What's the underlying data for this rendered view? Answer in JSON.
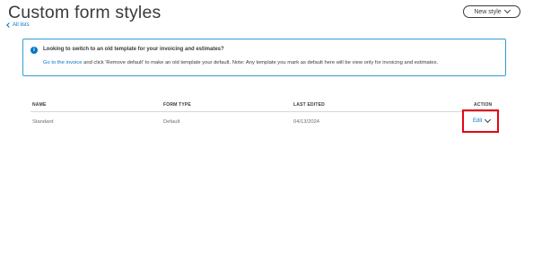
{
  "page": {
    "title": "Custom form styles",
    "back_link": "All lists",
    "new_style_button": "New style"
  },
  "info_banner": {
    "heading": "Looking to switch to an old template for your invoicing and estimates?",
    "link": "Go to the invoice",
    "text": " and click 'Remove default' to make an old template your default. Note: Any template you mark as default here will be view only for invoicing and estimates."
  },
  "table": {
    "columns": [
      "NAME",
      "FORM TYPE",
      "LAST EDITED",
      "ACTION"
    ],
    "rows": [
      {
        "name": "Standard",
        "form_type": "Default",
        "last_edited": "04/13/2024",
        "action": "Edit"
      }
    ]
  },
  "colors": {
    "link": "#0077c5",
    "banner_border": "#2f9fd7",
    "highlight": "#e30613"
  }
}
